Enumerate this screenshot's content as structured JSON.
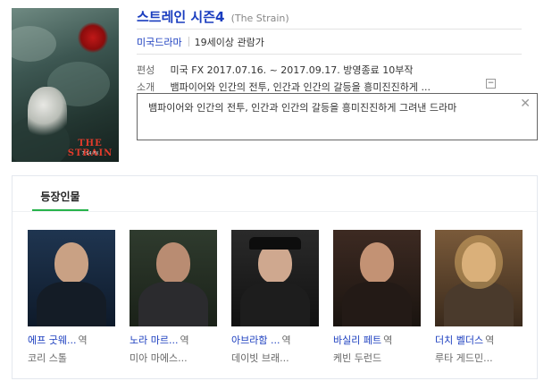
{
  "poster": {
    "title": "THE STRAIN",
    "sub": "7 14 FX"
  },
  "title": {
    "main": "스트레인 시즌4",
    "original": "(The Strain)"
  },
  "genre": {
    "label": "미국드라마",
    "rating": "19세이상 관람가"
  },
  "info": [
    {
      "label": "편성",
      "value": "미국 FX 2017.07.16. ~ 2017.09.17.",
      "status": "방영종료",
      "episodes": "10부작"
    },
    {
      "label": "소개",
      "value": "뱀파이어와 인간의 전투, 인간과 인간의 갈등을 흥미진진하게 ..."
    }
  ],
  "toggle": "−",
  "description": {
    "text": "뱀파이어와 인간의 전투, 인간과 인간의 갈등을 흥미진진하게 그려낸 드라마",
    "close": "✕"
  },
  "cast": {
    "tab": "등장인물",
    "members": [
      {
        "role": "에프 굿웨...",
        "tag": "역",
        "actor": "코리 스톨"
      },
      {
        "role": "노라 마르...",
        "tag": "역",
        "actor": "미아 마에스..."
      },
      {
        "role": "아브라함 ...",
        "tag": "역",
        "actor": "데이빗 브래..."
      },
      {
        "role": "바실리 페트",
        "tag": "역",
        "actor": "케빈 두런드"
      },
      {
        "role": "더치 벨더스",
        "tag": "역",
        "actor": "루타 게드민..."
      }
    ]
  },
  "colors": {
    "link": "#1a3dbf",
    "tab_accent": "#27b34b"
  }
}
